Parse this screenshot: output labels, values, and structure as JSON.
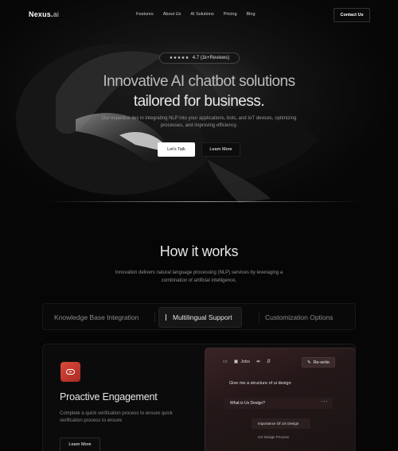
{
  "nav": {
    "logo_main": "Nexus.",
    "logo_ai": "ai",
    "links": [
      "Features",
      "About Us",
      "AI Solutions",
      "Pricing",
      "Blog"
    ],
    "contact_label": "Contact Us"
  },
  "hero": {
    "stars": "★★★★★",
    "rating": "4.7 (1k+Reviews)",
    "title_line1": "Innovative AI chatbot solutions",
    "title_line2": "tailored for business.",
    "subtitle": "Our expertise lies in integrating NLP into your applications, bots, and IoT devices, optimizing processes, and improving efficiency.",
    "primary_cta": "Let's Talk",
    "secondary_cta": "Learn More"
  },
  "how": {
    "title": "How it works",
    "subtitle": "Innovation delivers natural language processing (NLP) services by leveraging a combination of artificial intelligence,",
    "tabs": [
      "Knowledge Base Integration",
      "Multilingual Support",
      "Customization Options"
    ],
    "active_tab": 1
  },
  "feature": {
    "icon": "chat-bubble-icon",
    "title": "Proactive Engagement",
    "description": "Complete a quick verification process to ensure quick verification process to ensure",
    "button": "Learn More"
  },
  "chat_preview": {
    "toolbar": [
      "Jobs"
    ],
    "rewrite_label": "Re-write",
    "prompt": "Give me a structure of ui design",
    "suggestion": "What is Ux Design?",
    "more": "···",
    "sub_item_1": "Importance Of UX Design",
    "sub_item_2": "UX Design Process"
  },
  "colors": {
    "background": "#060606",
    "accent_red": "#d94a3c",
    "chat_panel": "#241718"
  }
}
